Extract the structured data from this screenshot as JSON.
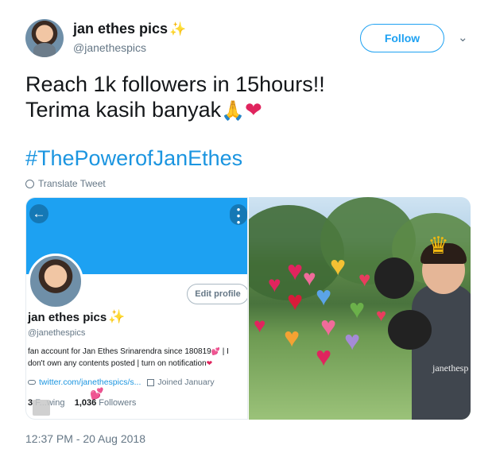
{
  "header": {
    "name": "jan ethes pics",
    "sparkle": "✨",
    "handle": "@janethespics",
    "follow_label": "Follow",
    "caret": "⌄"
  },
  "tweet": {
    "line1": "Reach 1k followers in 15hours!!",
    "line2": "Terima kasih banyak",
    "emoji_pray": "🙏",
    "emoji_heart": "❤",
    "hashtag": "#ThePowerofJanEthes",
    "translate_label": "Translate Tweet",
    "timestamp": "12:37 PM - 20 Aug 2018"
  },
  "profile_card": {
    "back": "←",
    "more": "•\n•\n•",
    "edit_label": "Edit profile",
    "name": "jan ethes pics",
    "sparkle": "✨",
    "handle": "@janethespics",
    "bio_1": "fan account for Jan Ethes Srinarendra since 180819",
    "bio_2": " | I don't own any contents posted | turn on notification",
    "heart": "💕",
    "link": "twitter.com/janethespics/s...",
    "joined": "Joined January",
    "following_count": "3",
    "following_label": " F...wing",
    "followers_count": "1,036",
    "followers_label": " Followers",
    "overlay_hearts": "💕"
  },
  "photo": {
    "watermark": "janethesp",
    "crown": "♛",
    "hearts": [
      "♥",
      "♥",
      "♥",
      "♥",
      "♥",
      "♥",
      "♥",
      "♥",
      "♥",
      "♥",
      "♥",
      "♥",
      "♥",
      "♥"
    ]
  },
  "colors": {
    "accent": "#1da1f2",
    "heart_red": "#e0245e"
  }
}
